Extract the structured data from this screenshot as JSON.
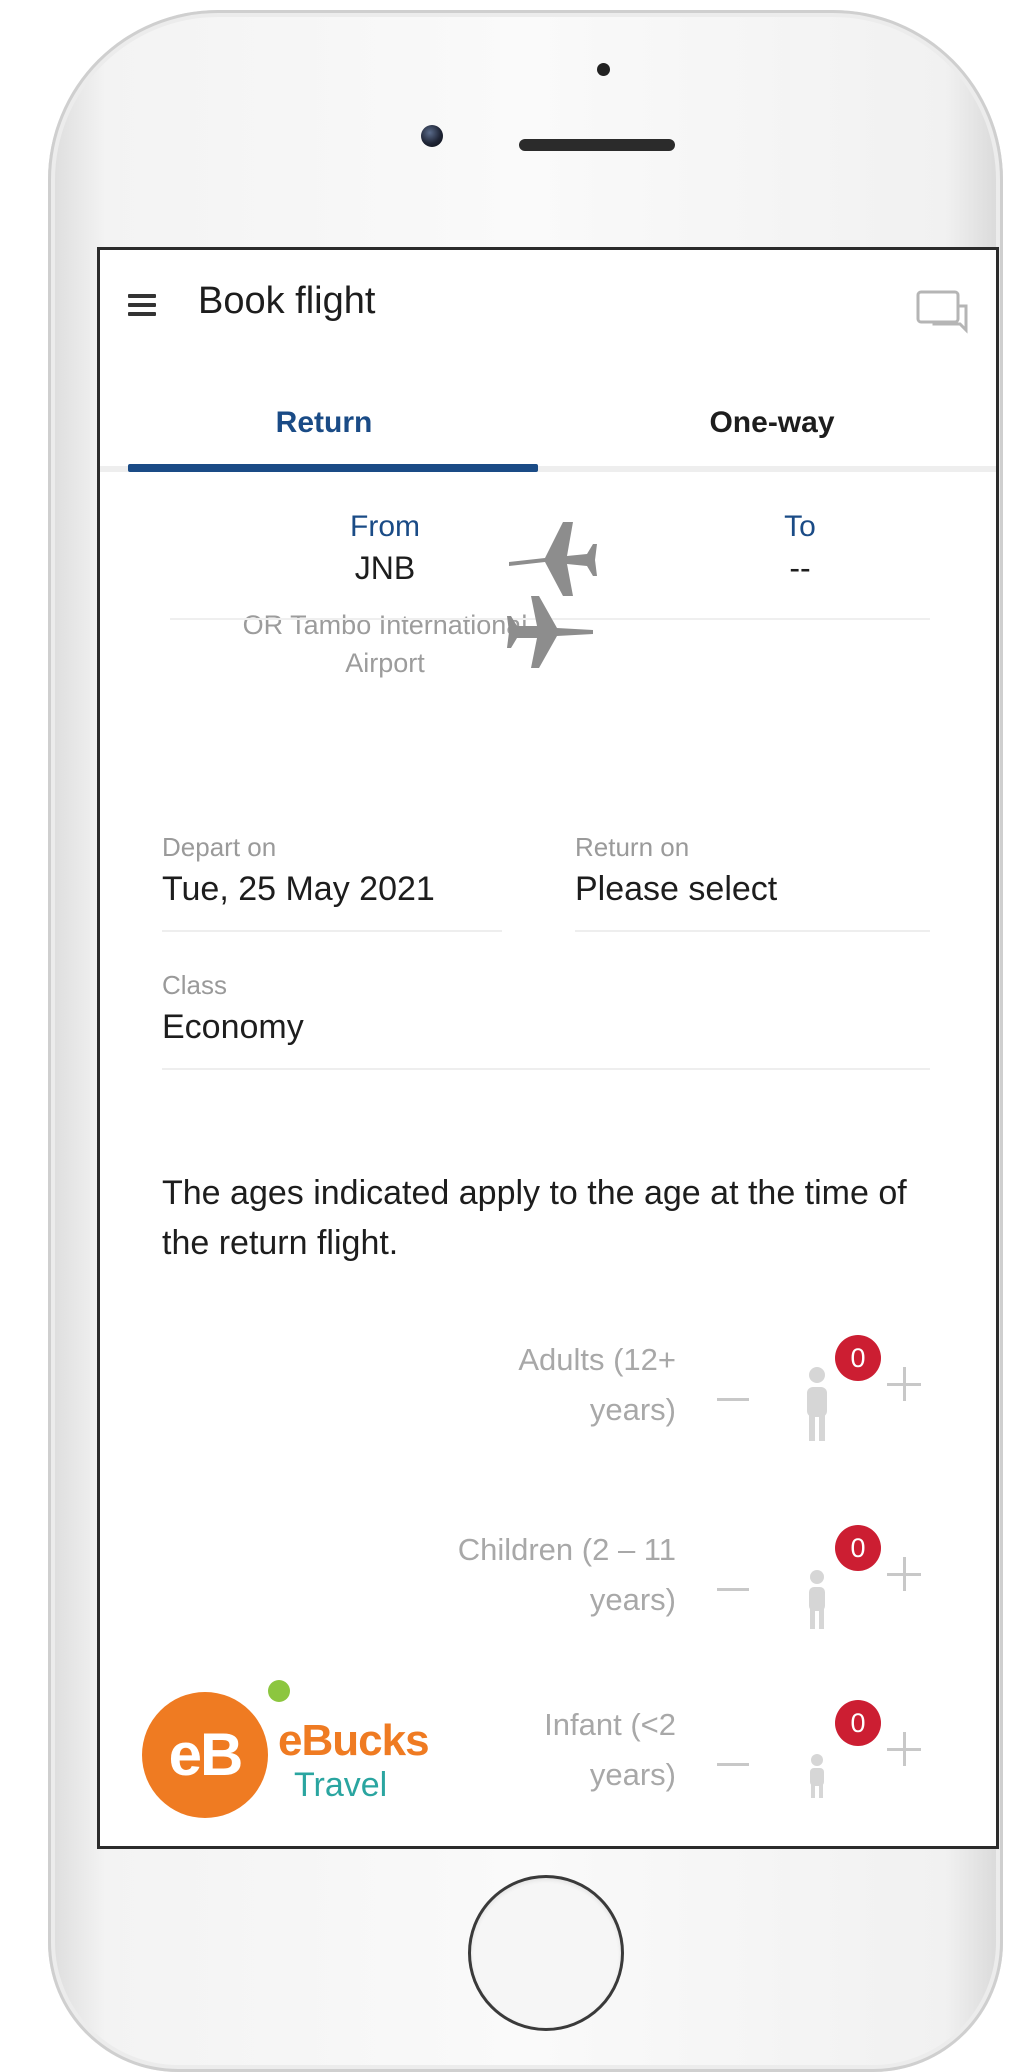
{
  "header": {
    "title": "Book flight"
  },
  "tabs": [
    {
      "label": "Return",
      "active": true
    },
    {
      "label": "One-way",
      "active": false
    }
  ],
  "route": {
    "from_label": "From",
    "from_code": "JNB",
    "from_airport": "OR Tambo International Airport",
    "to_label": "To",
    "to_value": "--"
  },
  "dates": {
    "depart_label": "Depart on",
    "depart_value": "Tue, 25 May 2021",
    "return_label": "Return on",
    "return_value": "Please select"
  },
  "travel_class": {
    "label": "Class",
    "value": "Economy"
  },
  "notice": "The ages indicated apply to the age at the time of the return flight.",
  "passengers": [
    {
      "label_line1": "Adults (12+",
      "label_line2": "years)",
      "count": "0"
    },
    {
      "label_line1": "Children (2 – 11",
      "label_line2": "years)",
      "count": "0"
    },
    {
      "label_line1": "Infant (<2",
      "label_line2": "years)",
      "count": "0"
    }
  ],
  "branding": {
    "logo_mark": "eB",
    "logo_word": "eBucks",
    "logo_sub": "Travel"
  },
  "colors": {
    "accent": "#1a4b86",
    "badge": "#cc1e32",
    "brand_orange": "#ef7b22",
    "brand_green": "#8cc63f",
    "brand_teal": "#2aa5a0"
  },
  "icons": [
    "menu-icon",
    "chat-icon",
    "plane-icon",
    "person-icon",
    "minus-icon",
    "plus-icon"
  ]
}
